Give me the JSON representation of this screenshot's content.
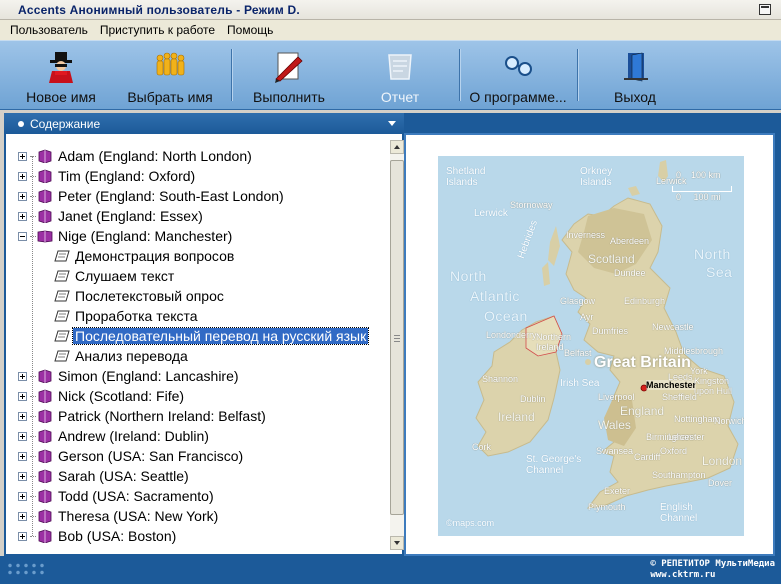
{
  "window": {
    "title": "Accents  Анонимный пользователь - Режим D."
  },
  "menu": [
    "Пользователь",
    "Приступить к работе",
    "Помощь"
  ],
  "toolbar": {
    "new_name": "Новое имя",
    "choose_name": "Выбрать имя",
    "execute": "Выполнить",
    "report": "Отчет",
    "about": "О программе...",
    "exit": "Выход"
  },
  "panel": {
    "title": "Содержание"
  },
  "tree": [
    {
      "label": "Adam (England: North London)",
      "expanded": false
    },
    {
      "label": "Tim (England: Oxford)",
      "expanded": false
    },
    {
      "label": "Peter (England: South-East London)",
      "expanded": false
    },
    {
      "label": "Janet (England: Essex)",
      "expanded": false
    },
    {
      "label": "Nige (England: Manchester)",
      "expanded": true,
      "children": [
        "Демонстрация вопросов",
        "Слушаем текст",
        "Послетекстовый опрос",
        "Проработка текста",
        "Последовательный перевод на русский язык",
        "Анализ перевода"
      ],
      "selected_child": 4
    },
    {
      "label": "Simon (England: Lancashire)",
      "expanded": false
    },
    {
      "label": "Nick (Scotland: Fife)",
      "expanded": false
    },
    {
      "label": "Patrick (Northern Ireland: Belfast)",
      "expanded": false
    },
    {
      "label": "Andrew (Ireland: Dublin)",
      "expanded": false
    },
    {
      "label": "Gerson (USA: San Francisco)",
      "expanded": false
    },
    {
      "label": "Sarah (USA: Seattle)",
      "expanded": false
    },
    {
      "label": "Todd (USA: Sacramento)",
      "expanded": false
    },
    {
      "label": "Theresa (USA: New York)",
      "expanded": false
    },
    {
      "label": "Bob (USA: Boston)",
      "expanded": false
    }
  ],
  "map": {
    "labels": {
      "shetland": "Shetland\nIslands",
      "orkney": "Orkney\nIslands",
      "lerwick": "Lerwick",
      "stornoway": "Stornoway",
      "hebrides": "Hebrides",
      "inverness": "Inverness",
      "aberdeen": "Aberdeen",
      "scotland": "Scotland",
      "dundee": "Dundee",
      "north_atlantic": "North",
      "atlantic": "Atlantic",
      "ocean": "Ocean",
      "glasgow": "Glasgow",
      "edinburgh": "Edinburgh",
      "ayr": "Ayr",
      "londonderry": "Londonderry",
      "northern_ireland": "Northern\nIreland",
      "belfast": "Belfast",
      "dumfries": "Dumfries",
      "newcastle": "Newcastle",
      "north_sea": "North",
      "sea": "Sea",
      "middlesbrough": "Middlesbrough",
      "great_britain": "Great Britain",
      "irish_sea": "Irish Sea",
      "york": "York",
      "manchester": "Manchester",
      "leeds": "Leeds",
      "kingston": "Kingston\nupon Hull",
      "shannon": "Shannon",
      "dublin": "Dublin",
      "liverpool": "Liverpool",
      "sheffield": "Sheffield",
      "ireland": "Ireland",
      "wales": "Wales",
      "england": "England",
      "nottingham": "Nottingham",
      "norwich": "Norwich",
      "birmingham": "Birmingham",
      "cork": "Cork",
      "swansea": "Swansea",
      "leicester": "Leicester",
      "cardiff": "Cardiff",
      "oxford": "Oxford",
      "london": "London",
      "stgeorges": "St. George's\nChannel",
      "southampton": "Southampton",
      "exeter": "Exeter",
      "plymouth": "Plymouth",
      "dover": "Dover",
      "english_channel": "English\nChannel",
      "km": "0    100 km",
      "mi": "0     100 mi",
      "logo": "©maps.com"
    }
  },
  "footer": {
    "copyright": "© РЕПЕТИТОР МультиМедиа\nwww.cktrm.ru"
  },
  "colors": {
    "accent": "#1c5a99",
    "selection": "#316ac5",
    "toolbar": "#7fb0dc"
  }
}
